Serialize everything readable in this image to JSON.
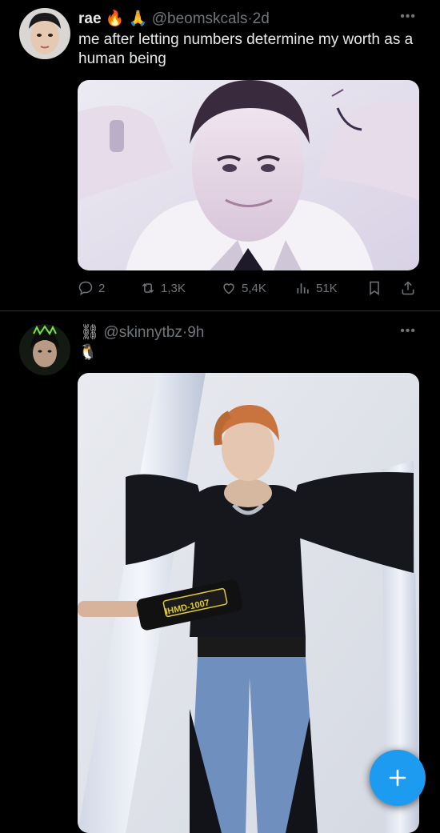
{
  "tweets": [
    {
      "name": "rae",
      "emoji_1": "🔥",
      "emoji_2": "🙏",
      "handle": "@beomskcals",
      "time": "2d",
      "text": "me after letting numbers determine my worth as a human being",
      "actions": {
        "replies": "2",
        "retweets": "1,3K",
        "likes": "5,4K",
        "views": "51K"
      }
    },
    {
      "name_symbol": "⛓",
      "handle": "@skinnytbz",
      "time": "9h",
      "emoji": "🐧",
      "media_label": "IHMD-1007"
    }
  ],
  "separator": "·",
  "more_label": "•••",
  "fab_label": "+",
  "icons": {
    "reply": "reply-icon",
    "retweet": "retweet-icon",
    "like": "heart-icon",
    "views": "views-icon",
    "bookmark": "bookmark-icon",
    "share": "share-icon",
    "compose": "plus-icon"
  },
  "colors": {
    "accent": "#1d9bf0",
    "muted": "#71767b",
    "text": "#e7e9ea"
  }
}
